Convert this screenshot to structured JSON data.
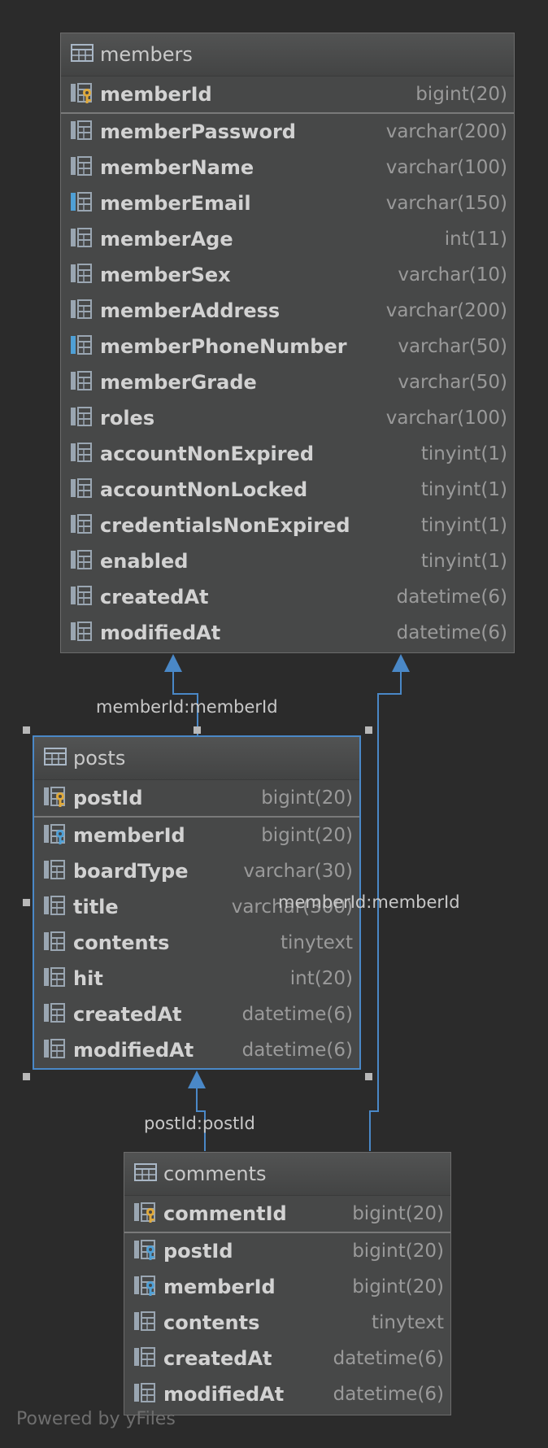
{
  "tables": {
    "members": {
      "name": "members",
      "columns": [
        {
          "name": "memberId",
          "type": "bigint(20)",
          "icon": "primary-key-icon"
        },
        {
          "name": "memberPassword",
          "type": "varchar(200)",
          "icon": "column-icon"
        },
        {
          "name": "memberName",
          "type": "varchar(100)",
          "icon": "column-icon"
        },
        {
          "name": "memberEmail",
          "type": "varchar(150)",
          "icon": "unique-column-icon"
        },
        {
          "name": "memberAge",
          "type": "int(11)",
          "icon": "column-icon"
        },
        {
          "name": "memberSex",
          "type": "varchar(10)",
          "icon": "column-icon"
        },
        {
          "name": "memberAddress",
          "type": "varchar(200)",
          "icon": "column-icon"
        },
        {
          "name": "memberPhoneNumber",
          "type": "varchar(50)",
          "icon": "unique-column-icon"
        },
        {
          "name": "memberGrade",
          "type": "varchar(50)",
          "icon": "column-icon"
        },
        {
          "name": "roles",
          "type": "varchar(100)",
          "icon": "column-icon"
        },
        {
          "name": "accountNonExpired",
          "type": "tinyint(1)",
          "icon": "column-icon"
        },
        {
          "name": "accountNonLocked",
          "type": "tinyint(1)",
          "icon": "column-icon"
        },
        {
          "name": "credentialsNonExpired",
          "type": "tinyint(1)",
          "icon": "column-icon"
        },
        {
          "name": "enabled",
          "type": "tinyint(1)",
          "icon": "column-icon"
        },
        {
          "name": "createdAt",
          "type": "datetime(6)",
          "icon": "column-icon"
        },
        {
          "name": "modifiedAt",
          "type": "datetime(6)",
          "icon": "column-icon"
        }
      ]
    },
    "posts": {
      "name": "posts",
      "columns": [
        {
          "name": "postId",
          "type": "bigint(20)",
          "icon": "primary-key-icon"
        },
        {
          "name": "memberId",
          "type": "bigint(20)",
          "icon": "foreign-key-icon"
        },
        {
          "name": "boardType",
          "type": "varchar(30)",
          "icon": "column-icon"
        },
        {
          "name": "title",
          "type": "varchar(300)",
          "icon": "column-icon"
        },
        {
          "name": "contents",
          "type": "tinytext",
          "icon": "column-icon"
        },
        {
          "name": "hit",
          "type": "int(20)",
          "icon": "column-icon"
        },
        {
          "name": "createdAt",
          "type": "datetime(6)",
          "icon": "column-icon"
        },
        {
          "name": "modifiedAt",
          "type": "datetime(6)",
          "icon": "column-icon"
        }
      ]
    },
    "comments": {
      "name": "comments",
      "columns": [
        {
          "name": "commentId",
          "type": "bigint(20)",
          "icon": "primary-key-icon"
        },
        {
          "name": "postId",
          "type": "bigint(20)",
          "icon": "foreign-key-icon"
        },
        {
          "name": "memberId",
          "type": "bigint(20)",
          "icon": "foreign-key-icon"
        },
        {
          "name": "contents",
          "type": "tinytext",
          "icon": "column-icon"
        },
        {
          "name": "createdAt",
          "type": "datetime(6)",
          "icon": "column-icon"
        },
        {
          "name": "modifiedAt",
          "type": "datetime(6)",
          "icon": "column-icon"
        }
      ]
    }
  },
  "relations": {
    "posts_members": "memberId:memberId",
    "comments_members": "memberId:memberId",
    "comments_posts": "postId:postId"
  },
  "colors": {
    "edge": "#4a88c7",
    "primary_key": "#e0a93b",
    "foreign_key": "#4fa0d6"
  },
  "footer": "Powered by yFiles"
}
